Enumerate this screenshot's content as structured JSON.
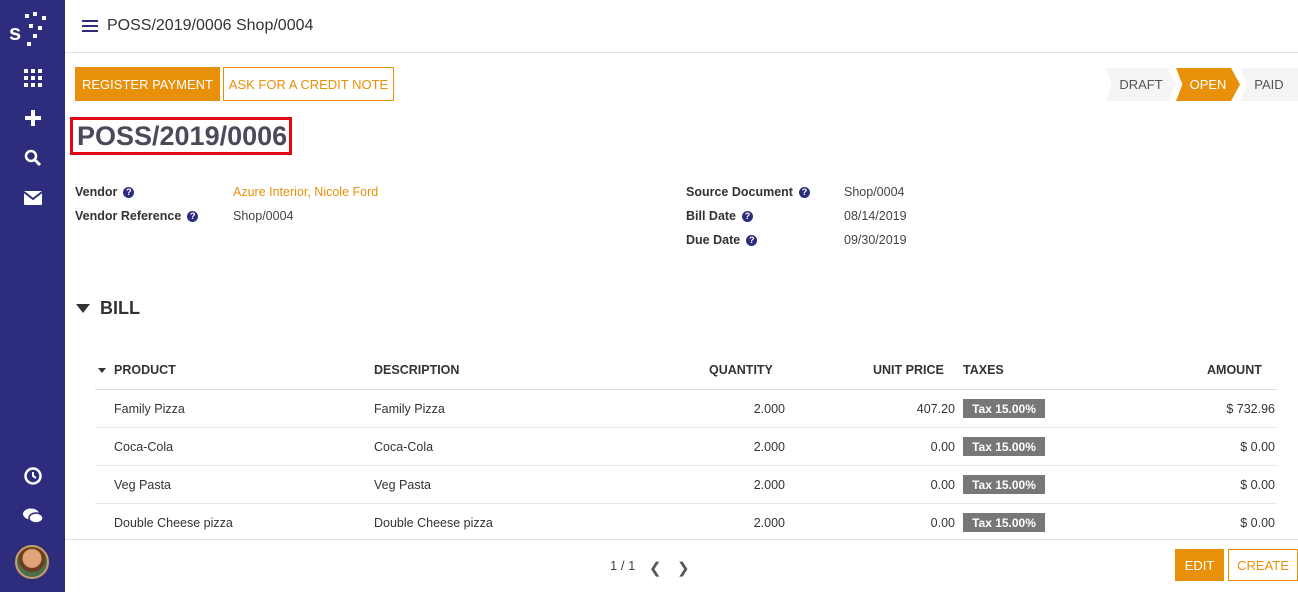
{
  "topbar": {
    "breadcrumb": "POSS/2019/0006 Shop/0004"
  },
  "actions": {
    "register_payment": "REGISTER PAYMENT",
    "credit_note": "ASK FOR A CREDIT NOTE"
  },
  "status": {
    "draft": "DRAFT",
    "open": "OPEN",
    "paid": "PAID",
    "active": "OPEN"
  },
  "document": {
    "title": "POSS/2019/0006"
  },
  "fields": {
    "vendor_label": "Vendor",
    "vendor_value": "Azure Interior, Nicole Ford",
    "vendor_ref_label": "Vendor Reference",
    "vendor_ref_value": "Shop/0004",
    "source_doc_label": "Source Document",
    "source_doc_value": "Shop/0004",
    "bill_date_label": "Bill Date",
    "bill_date_value": "08/14/2019",
    "due_date_label": "Due Date",
    "due_date_value": "09/30/2019"
  },
  "section": {
    "title": "BILL"
  },
  "table": {
    "headers": {
      "product": "PRODUCT",
      "description": "DESCRIPTION",
      "quantity": "QUANTITY",
      "unit_price": "UNIT PRICE",
      "taxes": "TAXES",
      "amount": "AMOUNT"
    },
    "rows": [
      {
        "product": "Family Pizza",
        "description": "Family Pizza",
        "quantity": "2.000",
        "unit_price": "407.20",
        "tax": "Tax 15.00%",
        "amount": "$ 732.96"
      },
      {
        "product": "Coca-Cola",
        "description": "Coca-Cola",
        "quantity": "2.000",
        "unit_price": "0.00",
        "tax": "Tax 15.00%",
        "amount": "$ 0.00"
      },
      {
        "product": "Veg Pasta",
        "description": "Veg Pasta",
        "quantity": "2.000",
        "unit_price": "0.00",
        "tax": "Tax 15.00%",
        "amount": "$ 0.00"
      },
      {
        "product": "Double Cheese pizza",
        "description": "Double Cheese pizza",
        "quantity": "2.000",
        "unit_price": "0.00",
        "tax": "Tax 15.00%",
        "amount": "$ 0.00"
      }
    ]
  },
  "footer": {
    "pager": "1 / 1",
    "edit": "EDIT",
    "create": "CREATE"
  },
  "colors": {
    "sidebar": "#2e2d7d",
    "accent": "#e8900a",
    "highlight_border": "#e30613",
    "tax_badge": "#777777"
  },
  "icons": {
    "sidebar": [
      "apps-grid-icon",
      "plus-icon",
      "search-icon",
      "mail-icon",
      "clock-icon",
      "chat-icon"
    ]
  }
}
